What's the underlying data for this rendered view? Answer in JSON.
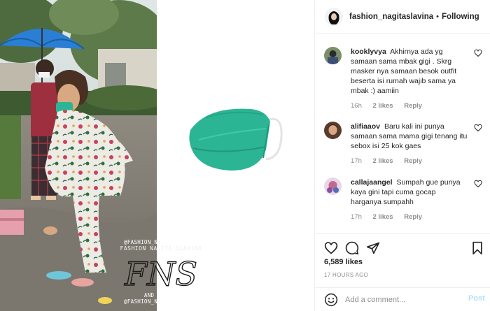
{
  "media": {
    "watermark": {
      "handle_top": "@FASHION_NAGITASLAVINA",
      "name": "FASHION NAGITA SLAVINA",
      "logo": "FNS",
      "tagline": "AND FAMILY",
      "handle_bottom": "@FASHION_NAGITASLAVINA"
    }
  },
  "post": {
    "username": "fashion_nagitaslavina",
    "separator": "•",
    "follow_label": "Following"
  },
  "comments": [
    {
      "user": "kooklyvya",
      "text": "Akhirnya ada yg samaan sama mbak gigi . Skrg masker nya samaan besok outfit beserta isi rumah wajib sama ya mbak :) aamiin",
      "time": "16h",
      "likes": "2 likes",
      "reply": "Reply"
    },
    {
      "user": "alifiaaov",
      "text": "Baru kali ini punya samaan sama mama gigi tenang itu sebox isi 25 kok gaes",
      "time": "17h",
      "likes": "2 likes",
      "reply": "Reply"
    },
    {
      "user": "callajaangel",
      "text": "Sumpah gue punya kaya gini tapi cuma gocap harganya sumpahh",
      "time": "17h",
      "likes": "2 likes",
      "reply": "Reply"
    }
  ],
  "likes_count": "6,589 likes",
  "timestamp": "17 HOURS AGO",
  "add_comment": {
    "placeholder": "Add a comment...",
    "post_label": "Post"
  },
  "icons": {
    "more": "more-options-icon",
    "heart": "heart-icon",
    "comment": "comment-icon",
    "share": "share-icon",
    "save": "bookmark-icon",
    "emoji": "emoji-icon"
  },
  "colors": {
    "mask": "#2bb594",
    "post_button": "#b2dffc",
    "meta_text": "#8e8e8e",
    "umbrella": "#2a7fd4"
  }
}
